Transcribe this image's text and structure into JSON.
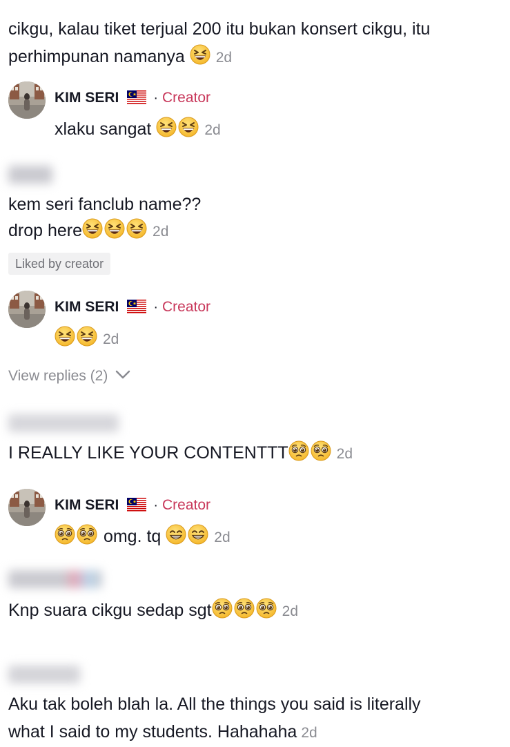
{
  "comments": [
    {
      "id": "c1",
      "lines": [
        "cikgu, kalau tiket terjual 200 itu bukan konsert cikgu, itu",
        "perhimpunan namanya"
      ],
      "emoji": [
        "grinning-squint"
      ],
      "time": "2d"
    },
    {
      "id": "c2",
      "lines": [
        "kem seri fanclub name??",
        "drop here"
      ],
      "emoji": [
        "grinning-squint",
        "grinning-squint",
        "grinning-squint"
      ],
      "time": "2d",
      "badge": "Liked by creator"
    },
    {
      "id": "c3",
      "lines": [
        "I REALLY LIKE YOUR CONTENTTT"
      ],
      "emoji": [
        "pleading",
        "pleading"
      ],
      "time": "2d"
    },
    {
      "id": "c4",
      "lines": [
        "Knp suara cikgu sedap sgt"
      ],
      "emoji": [
        "pleading",
        "pleading",
        "pleading"
      ],
      "time": "2d"
    },
    {
      "id": "c5",
      "lines": [
        "Aku tak boleh blah la. All the things you said is literally",
        "what I said to my students. Hahahaha"
      ],
      "time": "2d"
    }
  ],
  "replies": [
    {
      "id": "r1",
      "author": "KIM SERI",
      "flag": "malaysia-flag",
      "separator": "·",
      "role": "Creator",
      "text": "xlaku sangat",
      "emoji": [
        "grinning-squint",
        "grinning-squint"
      ],
      "time": "2d"
    },
    {
      "id": "r2",
      "author": "KIM SERI",
      "flag": "malaysia-flag",
      "separator": "·",
      "role": "Creator",
      "text": "",
      "emoji": [
        "grinning-squint",
        "grinning-squint"
      ],
      "time": "2d",
      "view_replies": "View replies (2)"
    },
    {
      "id": "r3",
      "author": "KIM SERI",
      "flag": "malaysia-flag",
      "separator": "·",
      "role": "Creator",
      "text_after_emoji": "omg. tq",
      "emoji": [
        "pleading",
        "pleading"
      ],
      "emoji_after": [
        "beaming",
        "beaming"
      ],
      "time": "2d"
    }
  ],
  "colors": {
    "creator": "#c8375a",
    "time": "#8a8b91",
    "text": "#161823",
    "badge_bg": "#f1f1f2"
  }
}
